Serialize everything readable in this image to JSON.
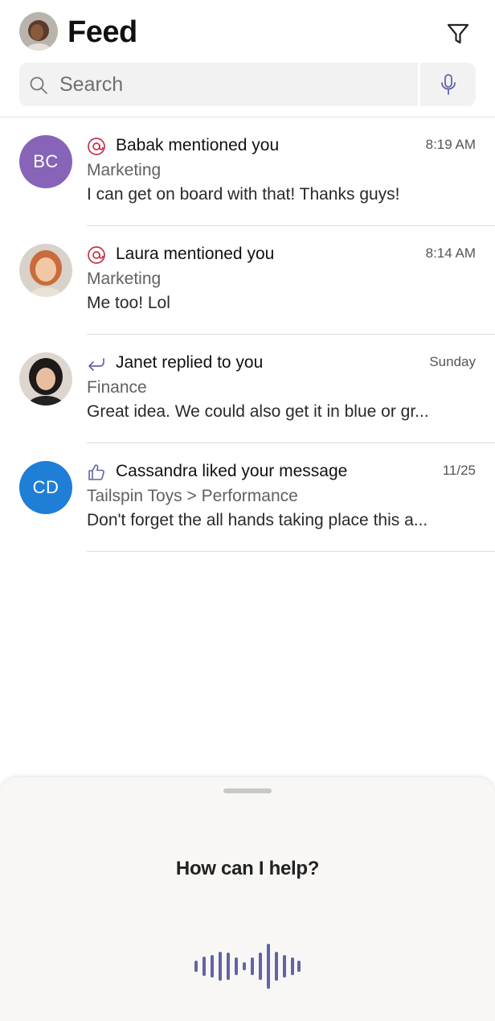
{
  "header": {
    "title": "Feed",
    "avatar_icon": "user-avatar",
    "filter_icon": "filter-icon"
  },
  "search": {
    "placeholder": "Search",
    "mic_icon": "microphone-icon"
  },
  "feed": [
    {
      "initials": "BC",
      "avatar_color": "#8764b8",
      "activity_icon": "mention-icon",
      "title": "Babak mentioned you",
      "time": "8:19 AM",
      "channel": "Marketing",
      "preview": "I can get on board with that! Thanks guys!"
    },
    {
      "initials": "",
      "avatar_color": "#d9a27c",
      "activity_icon": "mention-icon",
      "title": "Laura mentioned you",
      "time": "8:14 AM",
      "channel": "Marketing",
      "preview": "Me too! Lol"
    },
    {
      "initials": "",
      "avatar_color": "#3a3330",
      "activity_icon": "reply-icon",
      "title": "Janet replied to you",
      "time": "Sunday",
      "channel": "Finance",
      "preview": "Great idea. We could also get it in blue or gr..."
    },
    {
      "initials": "CD",
      "avatar_color": "#1f7ed6",
      "activity_icon": "like-icon",
      "title": "Cassandra liked your message",
      "time": "11/25",
      "channel": "Tailspin Toys > Performance",
      "preview": "Don't forget the all hands taking place this a..."
    }
  ],
  "assistant": {
    "prompt": "How can I help?",
    "wave_icon": "voice-waveform-icon"
  },
  "colors": {
    "accent": "#6264a7",
    "mention": "#c4314b"
  }
}
